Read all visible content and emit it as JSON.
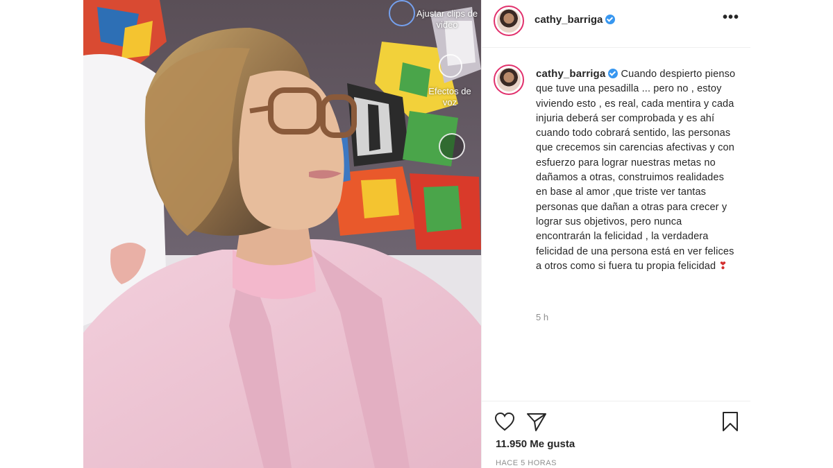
{
  "post": {
    "username": "cathy_barriga",
    "verified": true,
    "more_icon": "more-horizontal-icon",
    "overlay": {
      "adjust_clips": "Ajustar clips de video",
      "voice_effects": "Efectos de voz"
    },
    "caption": "Cuando despierto pienso que tuve una pesadilla ... pero no , estoy viviendo esto , es real, cada mentira y cada injuria deberá ser comprobada y es ahí cuando todo cobrará sentido, las personas que crecemos sin carencias afectivas y con esfuerzo para lograr nuestras metas no dañamos a otras, construimos realidades en base al amor ,que triste ver tantas personas que dañan a otras para crecer y lograr sus objetivos, pero nunca encontrarán la felicidad , la verdadera felicidad de una persona está en ver felices a otros como si fuera tu propia felicidad",
    "caption_emoji": "❣",
    "time_ago": "5 h",
    "likes": "11.950 Me gusta",
    "date": "HACE 5 HORAS"
  },
  "colors": {
    "verified": "#3897f0",
    "avatar_ring": "#e1306c",
    "secondary_text": "#8e8e8e",
    "coat_pink": "#f0c6d6"
  },
  "icons": [
    "heart-icon",
    "share-icon",
    "bookmark-icon",
    "verified-icon"
  ]
}
